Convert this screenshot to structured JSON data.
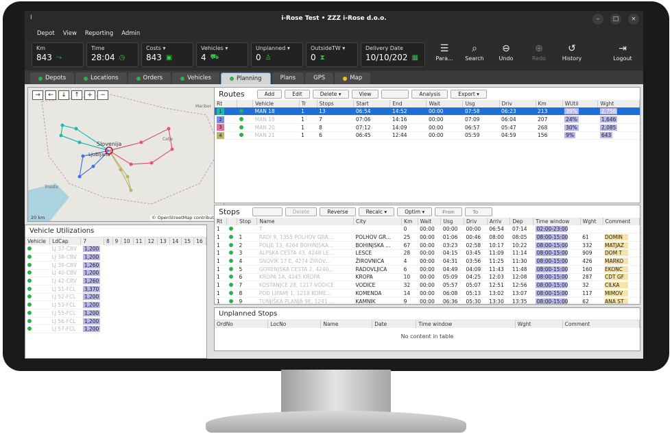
{
  "window": {
    "title": "i-Rose Test • ZZZ i-Rose d.o.o.",
    "app_icon": "I"
  },
  "menu": [
    "Depot",
    "View",
    "Reporting",
    "Admin"
  ],
  "kpis": [
    {
      "label": "Km",
      "value": "843",
      "icon": "route-icon"
    },
    {
      "label": "Time",
      "value": "28:04",
      "icon": "clock-icon"
    },
    {
      "label": "Costs",
      "value": "843",
      "icon": "money-icon"
    },
    {
      "label": "Vehicles",
      "value": "4",
      "icon": "truck-icon"
    },
    {
      "label": "Unplanned",
      "value": "0",
      "icon": "person-icon"
    },
    {
      "label": "OutsideTW",
      "value": "0",
      "icon": "hourglass-icon"
    },
    {
      "label": "Delivery Date",
      "value": "10/10/202",
      "icon": "calendar-icon"
    }
  ],
  "toolbar": {
    "params": "Para...",
    "search": "Search",
    "undo": "Undo",
    "redo": "Redo",
    "history": "History",
    "logout": "Logout"
  },
  "tabs": [
    {
      "label": "Depots",
      "dot": "green"
    },
    {
      "label": "Locations",
      "dot": "green"
    },
    {
      "label": "Orders",
      "dot": "green"
    },
    {
      "label": "Vehicles",
      "dot": "green"
    },
    {
      "label": "Planning",
      "dot": "green",
      "active": true
    },
    {
      "label": "Plans",
      "dot": ""
    },
    {
      "label": "GPS",
      "dot": ""
    },
    {
      "label": "Map",
      "dot": "yellow"
    }
  ],
  "map": {
    "buttons": [
      "→",
      "←",
      "↓",
      "↑",
      "+",
      "−"
    ],
    "labels": [
      "Slovenija",
      "Ljubljana",
      "Trieste",
      "Celje",
      "Maribor"
    ],
    "scale": "20 km",
    "attribution": "© OpenStreetMap contributors"
  },
  "vehicle_util": {
    "title": "Vehicle Utilizations",
    "headers": [
      "Vehicle",
      "LdCap",
      "7",
      "8",
      "9",
      "10",
      "11",
      "12",
      "13",
      "14",
      "15",
      "16"
    ],
    "rows": [
      {
        "vehicle": "LJ 37-CBV",
        "ldcap": "1,200"
      },
      {
        "vehicle": "LJ 38-CBV",
        "ldcap": "1,200"
      },
      {
        "vehicle": "LJ 39-CBV",
        "ldcap": "1,260"
      },
      {
        "vehicle": "LJ 40-CBV",
        "ldcap": "1,200"
      },
      {
        "vehicle": "LJ 42-CBV",
        "ldcap": "1,260"
      },
      {
        "vehicle": "LJ 51-FCL",
        "ldcap": "3,370"
      },
      {
        "vehicle": "LJ 52-FCL",
        "ldcap": "1,200"
      },
      {
        "vehicle": "LJ 53-FCL",
        "ldcap": "1,200"
      },
      {
        "vehicle": "LJ 55-FCL",
        "ldcap": "1,200"
      },
      {
        "vehicle": "LJ 56-FCL",
        "ldcap": "1,200"
      },
      {
        "vehicle": "LJ 57-FCL",
        "ldcap": "1,200"
      }
    ]
  },
  "routes": {
    "title": "Routes",
    "buttons": [
      "Add",
      "Edit",
      "Delete ▾",
      "View",
      "Analysis",
      "Export ▾"
    ],
    "headers": [
      "Rt",
      "",
      "Vehicle",
      "Tr",
      "Stops",
      "Start",
      "End",
      "Wait",
      "Usg",
      "Driv",
      "Km",
      "WUtil",
      "Wght"
    ],
    "rows": [
      {
        "rt": "1",
        "color": "#1cb8b0",
        "vehicle": "MAN 18",
        "tr": "1",
        "stops": "13",
        "start": "06:54",
        "end": "14:52",
        "wait": "00:00",
        "usg": "07:58",
        "driv": "06:23",
        "km": "213",
        "wutil": "39%",
        "wght": "2,756"
      },
      {
        "rt": "2",
        "color": "#7b8de8",
        "vehicle": "MAN 19",
        "tr": "1",
        "stops": "7",
        "start": "07:06",
        "end": "14:16",
        "wait": "00:00",
        "usg": "07:09",
        "driv": "06:04",
        "km": "207",
        "wutil": "24%",
        "wght": "1,646"
      },
      {
        "rt": "3",
        "color": "#e3759c",
        "vehicle": "MAN 20",
        "tr": "1",
        "stops": "8",
        "start": "07:12",
        "end": "14:09",
        "wait": "00:00",
        "usg": "06:57",
        "driv": "05:47",
        "km": "268",
        "wutil": "30%",
        "wght": "2,085"
      },
      {
        "rt": "4",
        "color": "#b8b46a",
        "vehicle": "MAN 21",
        "tr": "1",
        "stops": "6",
        "start": "06:45",
        "end": "12:44",
        "wait": "00:00",
        "usg": "05:59",
        "driv": "04:59",
        "km": "156",
        "wutil": "9%",
        "wght": "643"
      }
    ]
  },
  "stops": {
    "title": "Stops",
    "buttons": [
      "Delete",
      "Reverse",
      "Recalc ▾",
      "Optim ▾"
    ],
    "from_placeholder": "From",
    "to_placeholder": "To",
    "headers": [
      "Rt",
      "",
      "Stop",
      "Name",
      "City",
      "Km",
      "Wait",
      "Usg",
      "Driv",
      "Arriv",
      "Dep",
      "Time window",
      "Wght",
      "Comment"
    ],
    "rows": [
      {
        "rt": "1",
        "stop": "",
        "name": "T",
        "city": "",
        "km": "0",
        "wait": "00:00",
        "usg": "00:00",
        "driv": "00:00",
        "arriv": "06:54",
        "dep": "07:14",
        "tw": "02:00-23:00",
        "wght": "",
        "cmt": ""
      },
      {
        "rt": "1",
        "stop": "1",
        "name": "RADI 9, 1355 POLHOV GRA...",
        "city": "POLHOV GR...",
        "km": "25",
        "wait": "00:00",
        "usg": "01:06",
        "driv": "00:46",
        "arriv": "08:00",
        "dep": "08:05",
        "tw": "08:00-15:00",
        "wght": "61",
        "cmt": "DOMIN"
      },
      {
        "rt": "1",
        "stop": "2",
        "name": "POLJE 13, 4264 BOHINJSKA...",
        "city": "BOHINJSKA ...",
        "km": "67",
        "wait": "00:00",
        "usg": "03:23",
        "driv": "02:58",
        "arriv": "10:17",
        "dep": "10:22",
        "tw": "08:00-15:00",
        "wght": "332",
        "cmt": "MATJAZ"
      },
      {
        "rt": "1",
        "stop": "3",
        "name": "ALPSKA CESTA 43, 4248 LE...",
        "city": "LESCE",
        "km": "28",
        "wait": "00:00",
        "usg": "04:15",
        "driv": "03:45",
        "arriv": "11:09",
        "dep": "11:14",
        "tw": "08:00-15:00",
        "wght": "909",
        "cmt": "DOM T"
      },
      {
        "rt": "1",
        "stop": "4",
        "name": "SNOVIK 17 E, 4274 ŽIROV...",
        "city": "ŽIROVNICA",
        "km": "4",
        "wait": "00:00",
        "usg": "04:31",
        "driv": "03:56",
        "arriv": "11:25",
        "dep": "11:30",
        "tw": "08:00-15:00",
        "wght": "426",
        "cmt": "MARKO"
      },
      {
        "rt": "1",
        "stop": "5",
        "name": "GORENJSKA CESTA 2, 4240...",
        "city": "RADOVLJICA",
        "km": "6",
        "wait": "00:00",
        "usg": "04:49",
        "driv": "04:09",
        "arriv": "11:43",
        "dep": "11:48",
        "tw": "08:00-15:00",
        "wght": "160",
        "cmt": "EKONC"
      },
      {
        "rt": "1",
        "stop": "6",
        "name": "KROPA 1A, 4245 KROPA",
        "city": "KROPA",
        "km": "10",
        "wait": "00:00",
        "usg": "05:09",
        "driv": "04:25",
        "arriv": "12:03",
        "dep": "12:08",
        "tw": "08:00-15:00",
        "wght": "287",
        "cmt": "CDT GF"
      },
      {
        "rt": "1",
        "stop": "7",
        "name": "KOSTANJCE 28, 1217 VODICE",
        "city": "VODICE",
        "km": "32",
        "wait": "00:00",
        "usg": "05:57",
        "driv": "05:07",
        "arriv": "12:51",
        "dep": "12:56",
        "tw": "08:00-15:00",
        "wght": "32",
        "cmt": "CILKA"
      },
      {
        "rt": "1",
        "stop": "8",
        "name": "POD LIPAMI 1, 1218 KOME...",
        "city": "KOMENDA",
        "km": "14",
        "wait": "00:00",
        "usg": "06:08",
        "driv": "05:13",
        "arriv": "13:02",
        "dep": "13:07",
        "tw": "08:00-15:00",
        "wght": "117",
        "cmt": "MIMOV"
      },
      {
        "rt": "1",
        "stop": "9",
        "name": "TUNJIŠKA PLANJA 9E, 1241 ...",
        "city": "KAMNIK",
        "km": "9",
        "wait": "00:00",
        "usg": "06:36",
        "driv": "05:30",
        "arriv": "13:30",
        "dep": "13:35",
        "tw": "08:00-15:00",
        "wght": "62",
        "cmt": "ANA ST"
      }
    ]
  },
  "unplanned": {
    "title": "Unplanned Stops",
    "headers": [
      "OrdNo",
      "LocNo",
      "Name",
      "Date",
      "Time window",
      "Wght",
      "Comment"
    ],
    "empty": "No content in table"
  }
}
